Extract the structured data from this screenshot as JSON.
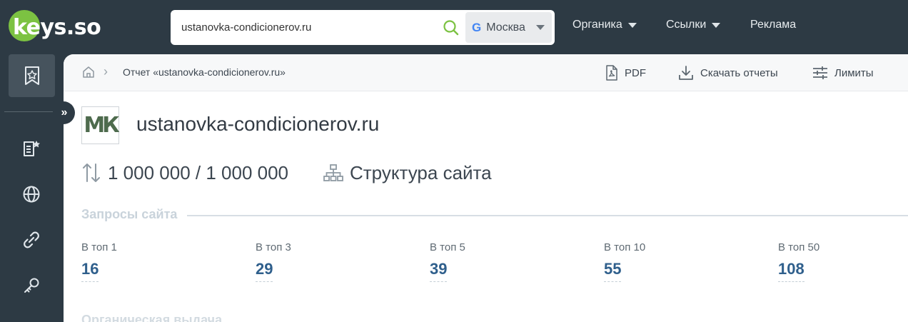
{
  "header": {
    "logo_text": "keys.so",
    "search": {
      "value": "ustanovka-condicionerov.ru"
    },
    "region": {
      "engine_icon": "G",
      "label": "Москва"
    },
    "nav": [
      {
        "label": "Органика"
      },
      {
        "label": "Ссылки"
      },
      {
        "label": "Реклама"
      }
    ]
  },
  "sidebar": {
    "items": [
      {
        "icon": "bookmark-star-icon",
        "active": true
      },
      {
        "icon": "list-star-icon"
      },
      {
        "icon": "globe-icon"
      },
      {
        "icon": "link-icon"
      },
      {
        "icon": "key-icon"
      }
    ],
    "expand_icon": "»"
  },
  "breadcrumb": {
    "home_icon": "home-icon",
    "separator": "›",
    "current": "Отчет «ustanovka-condicionerov.ru»"
  },
  "toolbar": {
    "pdf_label": "PDF",
    "download_label": "Скачать отчеты",
    "limits_label": "Лимиты"
  },
  "site": {
    "logo_text": "МК",
    "domain": "ustanovka-condicionerov.ru",
    "limits_text": "1 000 000 / 1 000 000",
    "structure_label": "Структура сайта"
  },
  "queries": {
    "heading": "Запросы сайта",
    "metrics": [
      {
        "label": "В топ 1",
        "value": "16"
      },
      {
        "label": "В топ 3",
        "value": "29"
      },
      {
        "label": "В топ 5",
        "value": "39"
      },
      {
        "label": "В топ 10",
        "value": "55"
      },
      {
        "label": "В топ 50",
        "value": "108"
      }
    ]
  },
  "organic": {
    "heading": "Органическая выдача"
  },
  "colors": {
    "dark_bg": "#2d3a44",
    "accent_green": "#7cc242",
    "link_blue": "#2f5f8c"
  }
}
